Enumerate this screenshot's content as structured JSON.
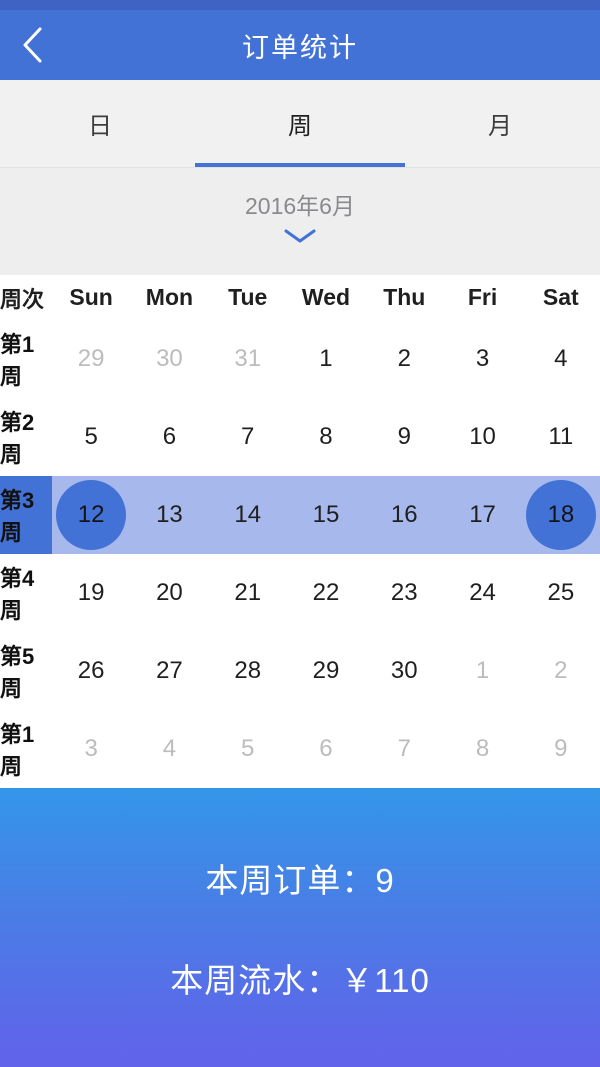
{
  "statusbar": {
    "color": "#3f63c4"
  },
  "header": {
    "title": "订单统计",
    "back_icon": "chevron-left-icon",
    "bg": "#4372d6"
  },
  "tabs": {
    "items": [
      {
        "label": "日",
        "active": false
      },
      {
        "label": "周",
        "active": true
      },
      {
        "label": "月",
        "active": false
      }
    ],
    "active_index": 1,
    "indicator_color": "#4372d6"
  },
  "month_selector": {
    "label": "2016年6月",
    "chevron_icon": "chevron-down-icon",
    "chevron_color": "#4372d6"
  },
  "calendar": {
    "week_col_header": "周次",
    "day_headers": [
      "Sun",
      "Mon",
      "Tue",
      "Wed",
      "Thu",
      "Fri",
      "Sat"
    ],
    "selected_row_index": 2,
    "selected_range_start": "12",
    "selected_range_end": "18",
    "highlight_band_color": "#a7b9ec",
    "highlight_accent_color": "#4372d6",
    "rows": [
      {
        "week_label": "第1周",
        "days": [
          {
            "num": "29",
            "muted": true
          },
          {
            "num": "30",
            "muted": true
          },
          {
            "num": "31",
            "muted": true
          },
          {
            "num": "1",
            "muted": false
          },
          {
            "num": "2",
            "muted": false
          },
          {
            "num": "3",
            "muted": false
          },
          {
            "num": "4",
            "muted": false
          }
        ]
      },
      {
        "week_label": "第2周",
        "days": [
          {
            "num": "5",
            "muted": false
          },
          {
            "num": "6",
            "muted": false
          },
          {
            "num": "7",
            "muted": false
          },
          {
            "num": "8",
            "muted": false
          },
          {
            "num": "9",
            "muted": false
          },
          {
            "num": "10",
            "muted": false
          },
          {
            "num": "11",
            "muted": false
          }
        ]
      },
      {
        "week_label": "第3周",
        "days": [
          {
            "num": "12",
            "muted": false
          },
          {
            "num": "13",
            "muted": false
          },
          {
            "num": "14",
            "muted": false
          },
          {
            "num": "15",
            "muted": false
          },
          {
            "num": "16",
            "muted": false
          },
          {
            "num": "17",
            "muted": false
          },
          {
            "num": "18",
            "muted": false
          }
        ]
      },
      {
        "week_label": "第4周",
        "days": [
          {
            "num": "19",
            "muted": false
          },
          {
            "num": "20",
            "muted": false
          },
          {
            "num": "21",
            "muted": false
          },
          {
            "num": "22",
            "muted": false
          },
          {
            "num": "23",
            "muted": false
          },
          {
            "num": "24",
            "muted": false
          },
          {
            "num": "25",
            "muted": false
          }
        ]
      },
      {
        "week_label": "第5周",
        "days": [
          {
            "num": "26",
            "muted": false
          },
          {
            "num": "27",
            "muted": false
          },
          {
            "num": "28",
            "muted": false
          },
          {
            "num": "29",
            "muted": false
          },
          {
            "num": "30",
            "muted": false
          },
          {
            "num": "1",
            "muted": true
          },
          {
            "num": "2",
            "muted": true
          }
        ]
      },
      {
        "week_label": "第1周",
        "days": [
          {
            "num": "3",
            "muted": true
          },
          {
            "num": "4",
            "muted": true
          },
          {
            "num": "5",
            "muted": true
          },
          {
            "num": "6",
            "muted": true
          },
          {
            "num": "7",
            "muted": true
          },
          {
            "num": "8",
            "muted": true
          },
          {
            "num": "9",
            "muted": true
          }
        ]
      }
    ]
  },
  "summary": {
    "orders_line": "本周订单：9",
    "revenue_line": "本周流水：￥110",
    "gradient_top": "#3496e9",
    "gradient_bottom": "#6262ea"
  }
}
